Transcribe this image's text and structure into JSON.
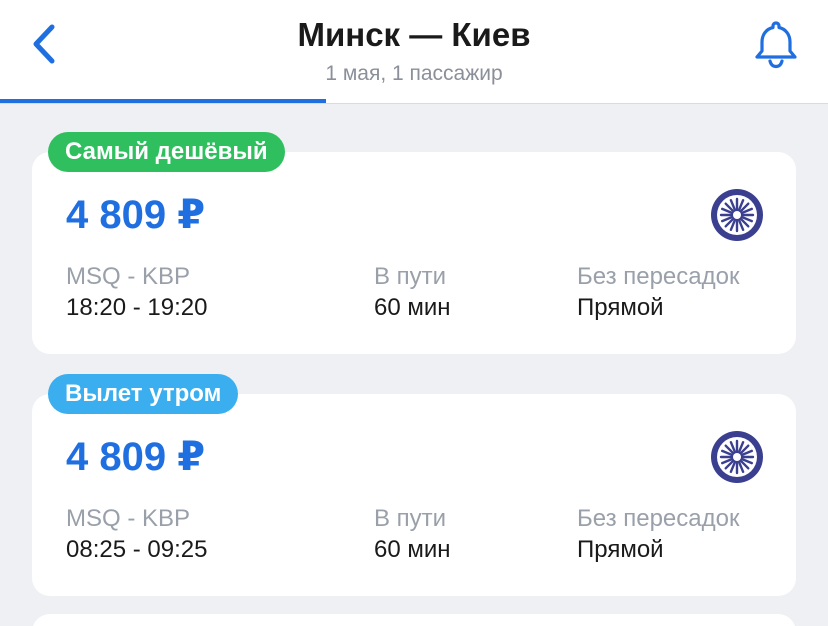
{
  "header": {
    "title": "Минск — Киев",
    "subtitle": "1 мая, 1 пассажир",
    "accent_color": "#1f6fe0",
    "back_icon": "chevron-left-icon",
    "bell_icon": "bell-icon"
  },
  "flights": [
    {
      "badge": "Самый дешёвый",
      "badge_color": "#2fbf5f",
      "price": "4 809 ₽",
      "route_label": "MSQ - KBP",
      "times": "18:20 - 19:20",
      "duration_label": "В пути",
      "duration": "60 мин",
      "stops_label": "Без пересадок",
      "stops": "Прямой",
      "airline_logo": "airline-logo-icon"
    },
    {
      "badge": "Вылет утром",
      "badge_color": "#3aaeee",
      "price": "4 809 ₽",
      "route_label": "MSQ - KBP",
      "times": "08:25 - 09:25",
      "duration_label": "В пути",
      "duration": "60 мин",
      "stops_label": "Без пересадок",
      "stops": "Прямой",
      "airline_logo": "airline-logo-icon"
    }
  ]
}
